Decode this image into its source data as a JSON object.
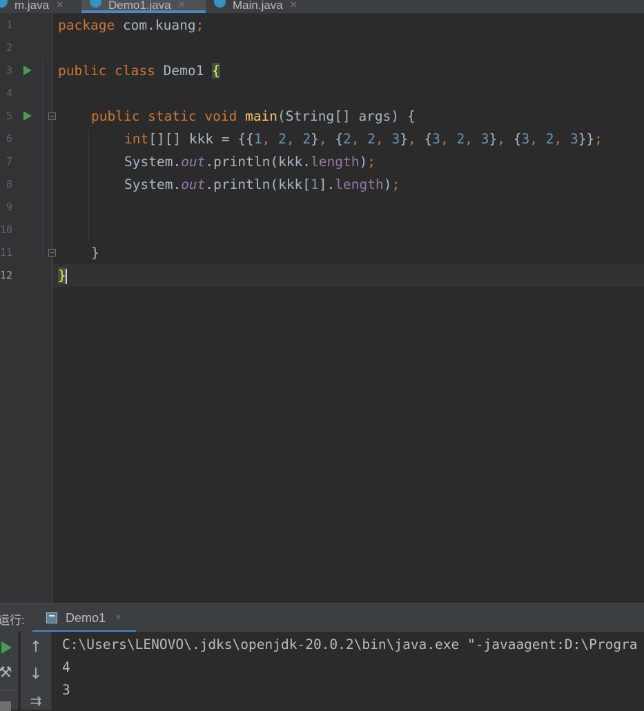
{
  "tabs": [
    {
      "label": "m.java",
      "active": false
    },
    {
      "label": "Demo1.java",
      "active": true
    },
    {
      "label": "Main.java",
      "active": false
    }
  ],
  "line_numbers": [
    "1",
    "2",
    "3",
    "4",
    "5",
    "6",
    "7",
    "8",
    "9",
    "10",
    "11",
    "12"
  ],
  "current_line": "12",
  "code": {
    "l1_kw": "package",
    "l1_rest": " com.kuang",
    "l1_semi": ";",
    "l3_kw": "public class",
    "l3_name": " Demo1 ",
    "l3_brace": "{",
    "l5_kw": "public static void",
    "l5_fn": "main",
    "l5_rest": "(String[] args) {",
    "l6_kw": "int",
    "l6_a": "[][] kkk = {{",
    "l6_n1": "1",
    "l6_c1": ", ",
    "l6_n2": "2",
    "l6_c2": ", ",
    "l6_n3": "2",
    "l6_b1": "}",
    "l6_c3": ", ",
    "l6_o2": "{",
    "l6_n4": "2",
    "l6_c4": ", ",
    "l6_n5": "2",
    "l6_c5": ", ",
    "l6_n6": "3",
    "l6_b2": "}",
    "l6_c6": ", ",
    "l6_o3": "{",
    "l6_n7": "3",
    "l6_c7": ", ",
    "l6_n8": "2",
    "l6_c8": ", ",
    "l6_n9": "3",
    "l6_b3": "}",
    "l6_c9": ", ",
    "l6_o4": "{",
    "l6_n10": "3",
    "l6_c10": ", ",
    "l6_n11": "2",
    "l6_c11": ", ",
    "l6_n12": "3",
    "l6_end": "}}",
    "l6_semi": ";",
    "l7_a": "System.",
    "l7_out": "out",
    "l7_b": ".println(kkk.",
    "l7_len": "length",
    "l7_c": ")",
    "l7_semi": ";",
    "l8_a": "System.",
    "l8_out": "out",
    "l8_b": ".println(kkk[",
    "l8_num": "1",
    "l8_c": "].",
    "l8_len": "length",
    "l8_d": ")",
    "l8_semi": ";",
    "l11_brace": "}",
    "l12_brace": "}"
  },
  "run_panel": {
    "label": "运行:",
    "tab_name": "Demo1",
    "tab_close": "×",
    "output": [
      "C:\\Users\\LENOVO\\.jdks\\openjdk-20.0.2\\bin\\java.exe \"-javaagent:D:\\Progra",
      "4",
      "3"
    ]
  },
  "icons": {
    "up": "↑",
    "down": "↓",
    "wrap": "⇉",
    "wrench": "🔧"
  }
}
